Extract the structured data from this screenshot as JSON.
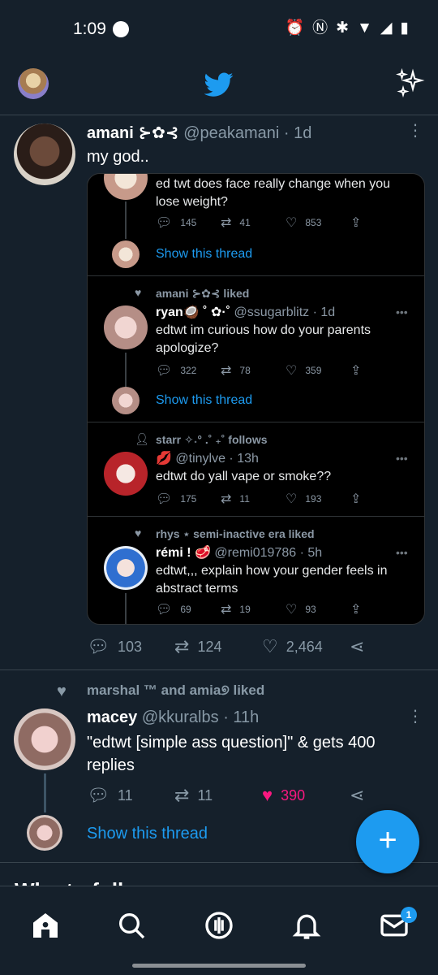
{
  "status_bar": {
    "time": "1:09"
  },
  "tweet1": {
    "name": "amani ⊱✿⊰",
    "handle": "@peakamani",
    "time": "· 1d",
    "text": "my god..",
    "embedded": [
      {
        "text": "ed twt does face really change when you lose weight?",
        "reply": "145",
        "retweet": "41",
        "like": "853",
        "thread": "Show this thread"
      },
      {
        "social": "amani ⊱✿⊰ liked",
        "name": "ryan🥥 ˚ ✿·˚",
        "handle": "@ssugarblitz · 1d",
        "text": "edtwt im curious how do your parents apologize?",
        "reply": "322",
        "retweet": "78",
        "like": "359",
        "thread": "Show this thread"
      },
      {
        "social": "starr ✧˖° .˚ ₊˚ follows",
        "name": "💋",
        "handle": "@tinylve · 13h",
        "text": "edtwt do yall vape or smoke??",
        "reply": "175",
        "retweet": "11",
        "like": "193"
      },
      {
        "social": "rhys ⋆ semi-inactive era liked",
        "name": "rémi ! 🥩",
        "handle": "@remi019786 · 5h",
        "text": "edtwt,,, explain how your gender feels in abstract terms",
        "reply": "69",
        "retweet": "19",
        "like": "93"
      }
    ],
    "reply": "103",
    "retweet": "124",
    "like": "2,464"
  },
  "tweet2": {
    "social": "marshal ™ and amia୭ liked",
    "name": "macey",
    "handle": "@kkuralbs",
    "time": "· 11h",
    "text": "\"edtwt [simple ass question]\" & gets 400 replies",
    "reply": "11",
    "retweet": "11",
    "like": "390",
    "thread": "Show this thread"
  },
  "who_to_follow": "Who to follow",
  "nav": {
    "messages_badge": "1"
  },
  "colors": {
    "accent": "#1d9bf0",
    "like": "#f91880",
    "background": "#15202b"
  }
}
